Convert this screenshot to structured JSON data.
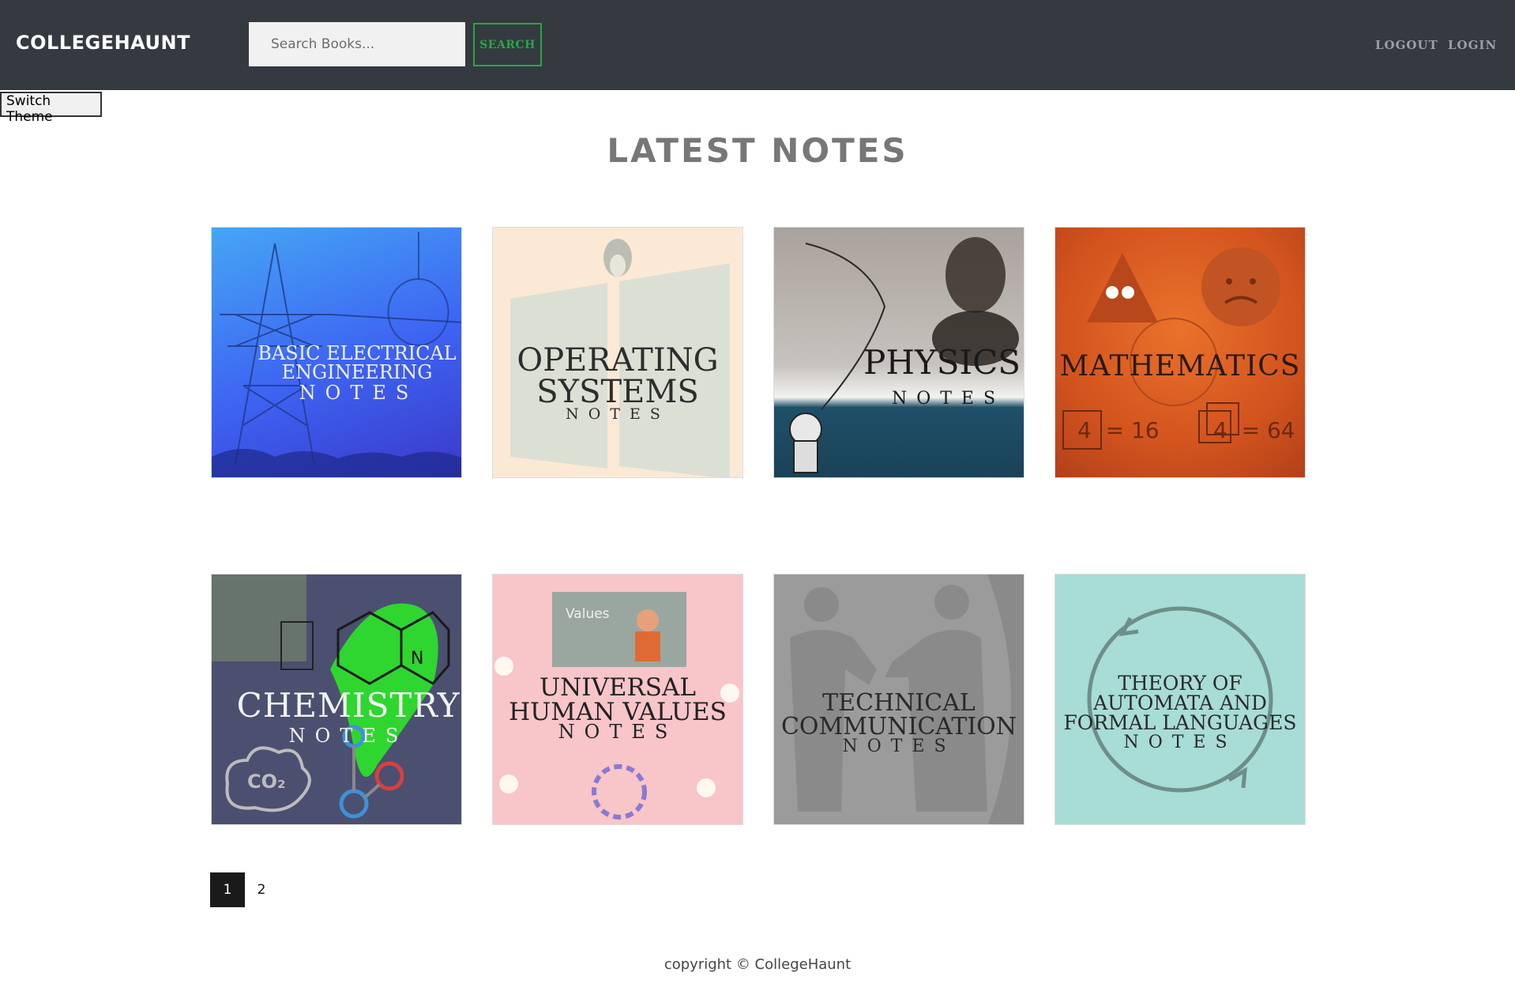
{
  "navbar": {
    "brand": "COLLEGEHAUNT",
    "search_placeholder": "Search Books...",
    "search_label": "SEARCH",
    "logout_label": "LOGOUT",
    "login_label": "LOGIN"
  },
  "switch_theme_label": "Switch Theme",
  "heading": "LATEST NOTES",
  "notes": [
    {
      "title": "BASIC ELECTRICAL ENGINEERING",
      "sub": "NOTES",
      "bg": "#3f6cf0"
    },
    {
      "title": "OPERATING SYSTEMS",
      "sub": "NOTES",
      "bg": "#fbe9d6"
    },
    {
      "title": "PHYSICS",
      "sub": "NOTES",
      "bg": "#b9b4b0"
    },
    {
      "title": "MATHEMATICS",
      "sub": "",
      "bg": "#d9531e"
    },
    {
      "title": "CHEMISTRY",
      "sub": "NOTES",
      "bg": "#4a5068"
    },
    {
      "title": "UNIVERSAL HUMAN VALUES",
      "sub": "NOTES",
      "bg": "#f8c7c9"
    },
    {
      "title": "TECHNICAL COMMUNICATION",
      "sub": "NOTES",
      "bg": "#9a9a9a"
    },
    {
      "title": "THEORY OF AUTOMATA AND FORMAL LANGUAGES",
      "sub": "NOTES",
      "bg": "#a8dcd6"
    }
  ],
  "card_extra": {
    "math_eq1": "4  = 16",
    "math_eq2": "4  = 64",
    "chem_formula": "CO₂",
    "uhv_values": "Values",
    "chem_n": "N"
  },
  "pagination": {
    "pages": [
      "1",
      "2"
    ],
    "active": "1"
  },
  "footer": "copyright © CollegeHaunt"
}
